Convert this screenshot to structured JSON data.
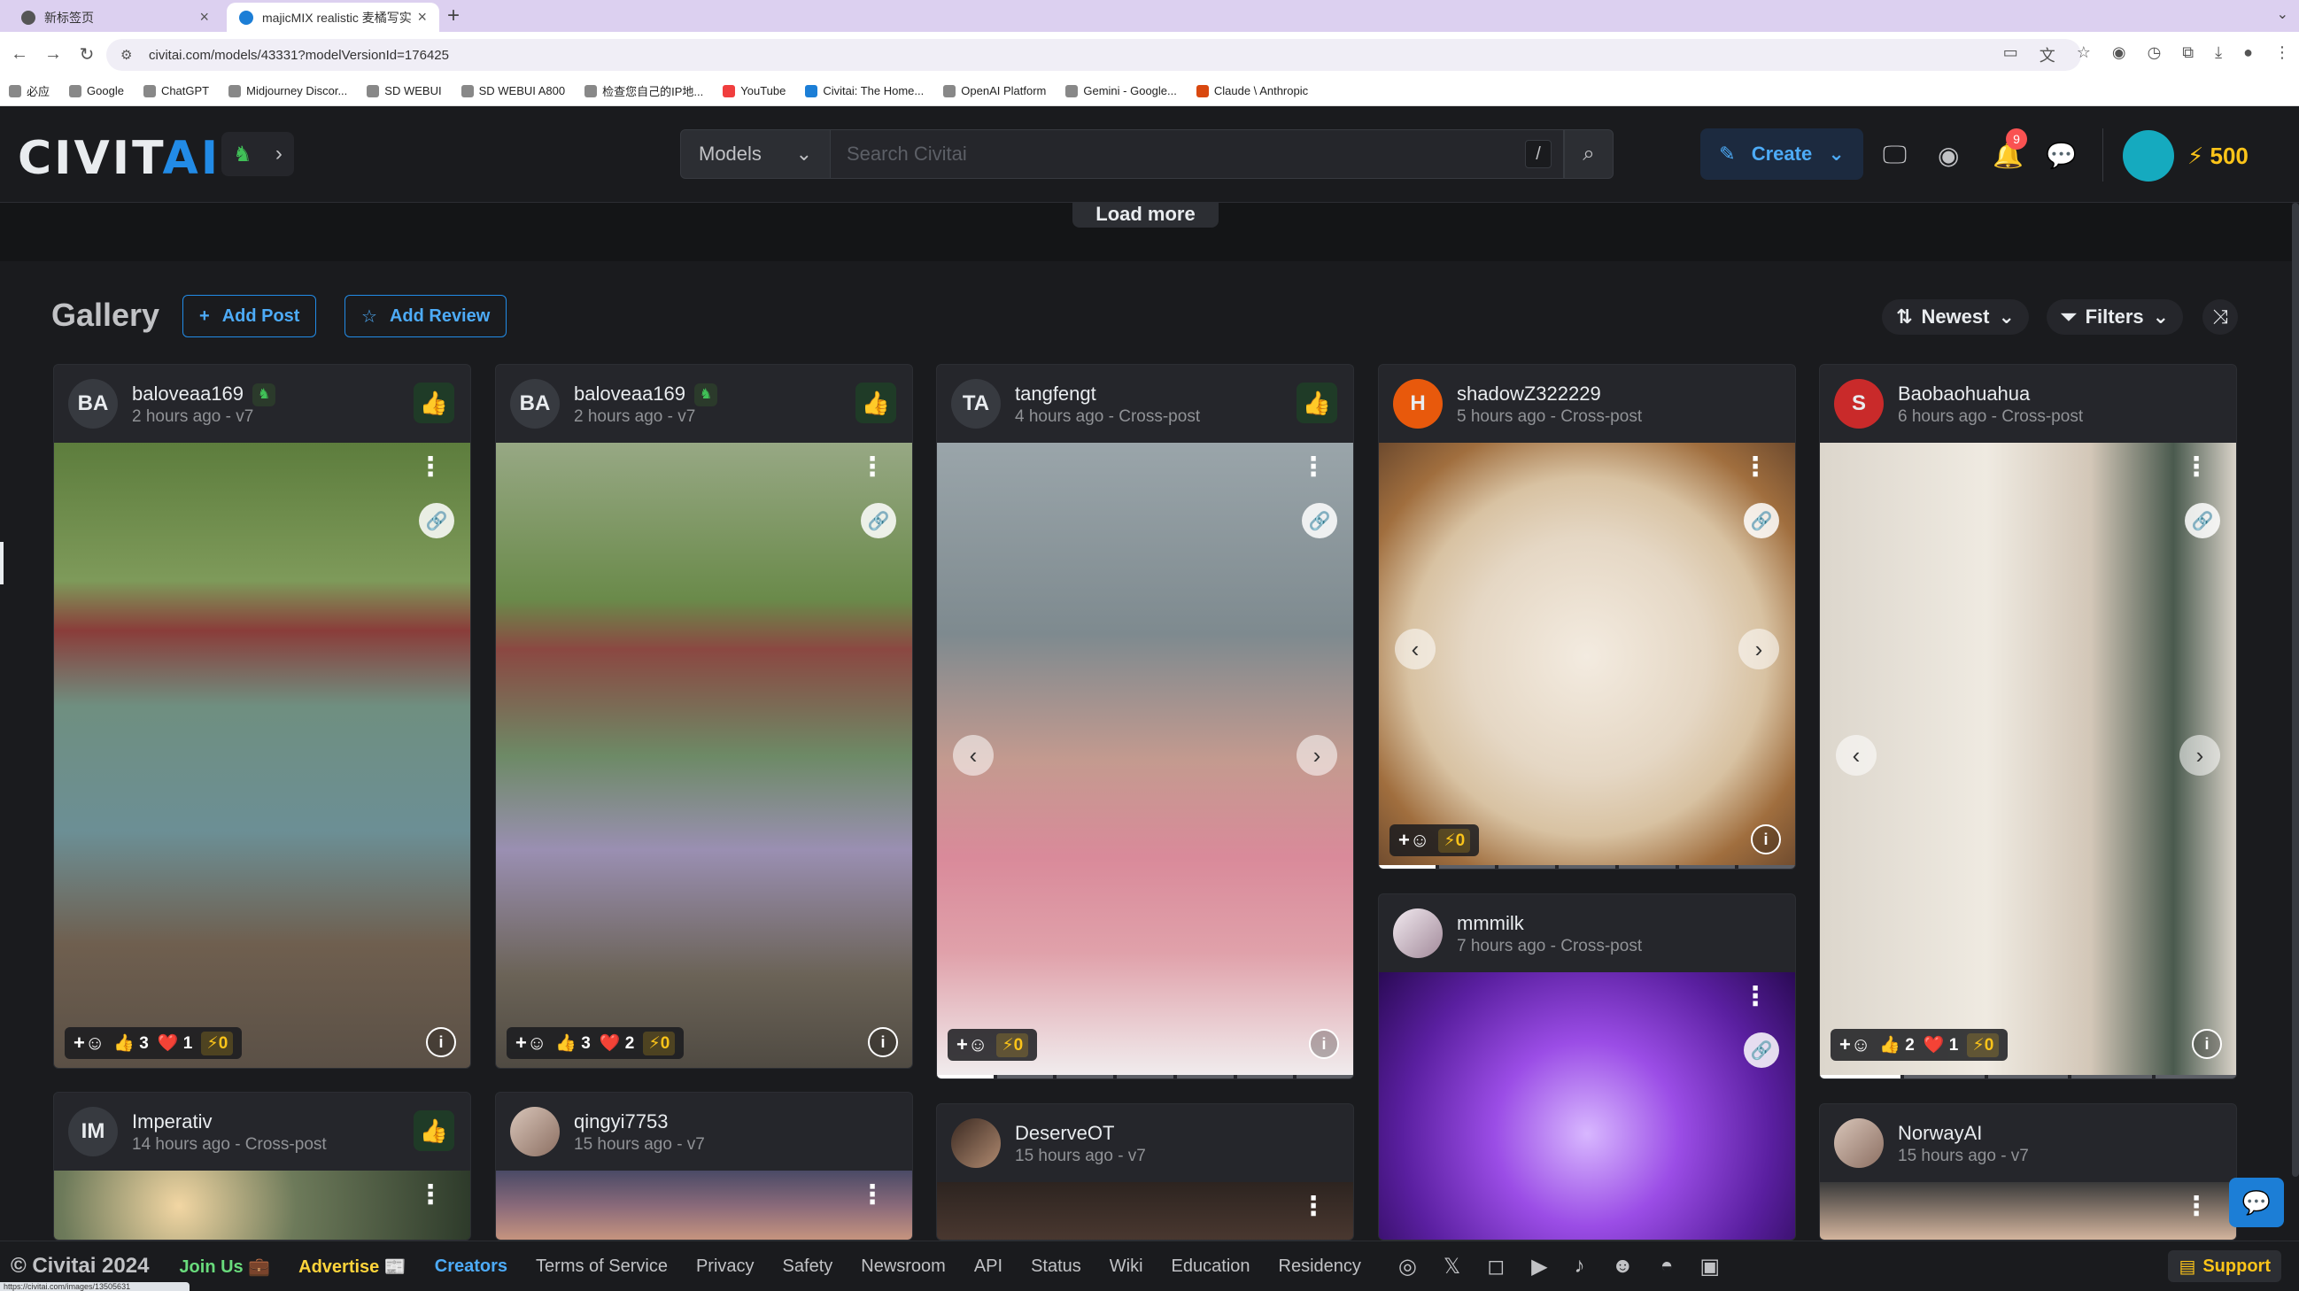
{
  "browser": {
    "tabs": [
      {
        "label": "新标签页",
        "active": false
      },
      {
        "label": "majicMIX realistic 麦橘写实 -",
        "active": true
      }
    ],
    "url": "civitai.com/models/43331?modelVersionId=176425",
    "bookmarks": [
      "必应",
      "Google",
      "ChatGPT",
      "Midjourney Discor...",
      "SD WEBUI",
      "SD WEBUI A800",
      "检查您自己的IP地...",
      "YouTube",
      "Civitai: The Home...",
      "OpenAI Platform",
      "Gemini - Google...",
      "Claude \\ Anthropic"
    ],
    "status_url": "https://civitai.com/images/13505631"
  },
  "header": {
    "logo_main": "CIVIT",
    "logo_accent": "AI",
    "search_scope": "Models",
    "search_placeholder": "Search Civitai",
    "search_shortcut": "/",
    "create_label": "Create",
    "notification_count": "9",
    "buzz_balance": "500"
  },
  "load_more_label": "Load more",
  "gallery": {
    "title": "Gallery",
    "add_post_label": "Add Post",
    "add_review_label": "Add Review",
    "sort_label": "Newest",
    "filters_label": "Filters"
  },
  "cards": [
    {
      "initials": "BA",
      "user": "baloveaa169",
      "meta": "2 hours ago - v7",
      "likes": "3",
      "hearts": "1",
      "buzz": "0"
    },
    {
      "initials": "BA",
      "user": "baloveaa169",
      "meta": "2 hours ago - v7",
      "likes": "3",
      "hearts": "2",
      "buzz": "0"
    },
    {
      "initials": "TA",
      "user": "tangfengt",
      "meta": "4 hours ago - Cross-post",
      "buzz": "0"
    },
    {
      "initials": "H",
      "user": "shadowZ322229",
      "meta": "5 hours ago - Cross-post",
      "buzz": "0"
    },
    {
      "initials": "S",
      "user": "Baobaohuahua",
      "meta": "6 hours ago - Cross-post",
      "likes": "2",
      "hearts": "1",
      "buzz": "0"
    },
    {
      "initials": "",
      "user": "mmmilk",
      "meta": "7 hours ago - Cross-post"
    },
    {
      "initials": "IM",
      "user": "Imperativ",
      "meta": "14 hours ago - Cross-post"
    },
    {
      "initials": "",
      "user": "qingyi7753",
      "meta": "15 hours ago - v7"
    },
    {
      "initials": "",
      "user": "DeserveOT",
      "meta": "15 hours ago - v7"
    },
    {
      "initials": "",
      "user": "NorwayAI",
      "meta": "15 hours ago - v7"
    }
  ],
  "footer": {
    "copyright": "© Civitai 2024",
    "links": [
      "Join Us 💼",
      "Advertise 📰",
      "Creators",
      "Terms of Service",
      "Privacy",
      "Safety",
      "Newsroom",
      "API",
      "Status",
      "Wiki",
      "Education",
      "Residency"
    ],
    "support_label": "Support"
  }
}
